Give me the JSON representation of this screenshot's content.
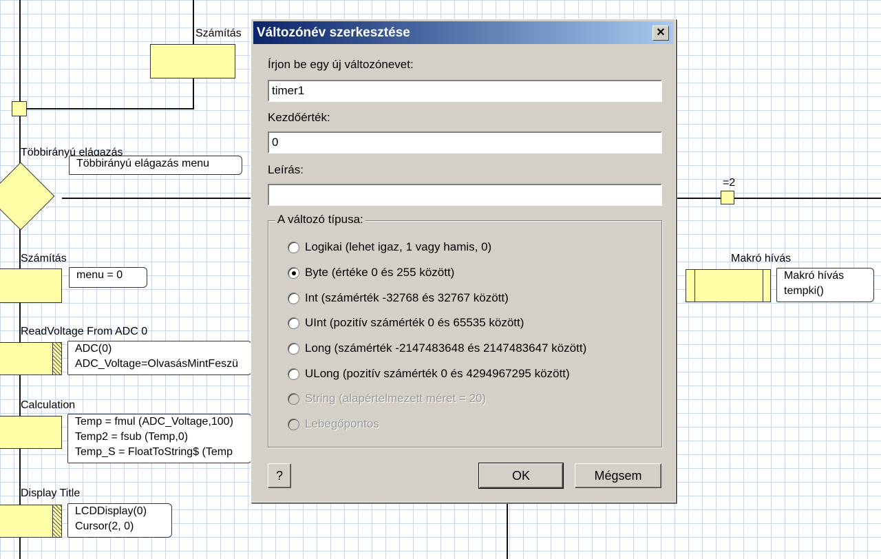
{
  "flowchart": {
    "top_calc_label": "Számítás",
    "switch_label": "Többirányú elágazás",
    "switch_note": "Többirányú elágazás menu",
    "branch_value": "=2",
    "calc_label": "Számítás",
    "calc_note": "menu = 0",
    "macro_label": "Makró hívás",
    "macro_note": [
      "Makró hívás",
      "tempki()"
    ],
    "read_label": "ReadVoltage From ADC 0",
    "read_note": [
      "ADC(0)",
      "ADC_Voltage=OlvasásMintFeszü"
    ],
    "calculation_label": "Calculation",
    "calculation_note": [
      "Temp = fmul (ADC_Voltage,100)",
      "Temp2 = fsub (Temp,0)",
      "Temp_S = FloatToString$ (Temp"
    ],
    "display_label": "Display Title",
    "display_note": [
      "LCDDisplay(0)",
      "Cursor(2, 0)"
    ]
  },
  "dialog": {
    "title": "Változónév szerkesztése",
    "close_symbol": "✕",
    "name_label": "Írjon be egy új változónevet:",
    "name_value": "timer1",
    "initial_label": "Kezdőérték:",
    "initial_value": "0",
    "description_label": "Leírás:",
    "description_value": "",
    "type_group_label": "A változó típusa:",
    "types": [
      {
        "label": "Logikai (lehet igaz, 1 vagy hamis, 0)",
        "checked": false,
        "disabled": false
      },
      {
        "label": "Byte (értéke 0 és 255 között)",
        "checked": true,
        "disabled": false
      },
      {
        "label": "Int (számérték -32768 és 32767 között)",
        "checked": false,
        "disabled": false
      },
      {
        "label": "UInt (pozitív számérték 0 és 65535 között)",
        "checked": false,
        "disabled": false
      },
      {
        "label": "Long (számérték -2147483648 és 2147483647 között)",
        "checked": false,
        "disabled": false
      },
      {
        "label": "ULong (pozitív számérték 0 és 4294967295 között)",
        "checked": false,
        "disabled": false
      },
      {
        "label": "String (alapértelmezett méret = 20)",
        "checked": false,
        "disabled": true
      },
      {
        "label": "Lebegőpontos",
        "checked": false,
        "disabled": true
      }
    ],
    "help_label": "?",
    "ok_label": "OK",
    "cancel_label": "Mégsem"
  }
}
